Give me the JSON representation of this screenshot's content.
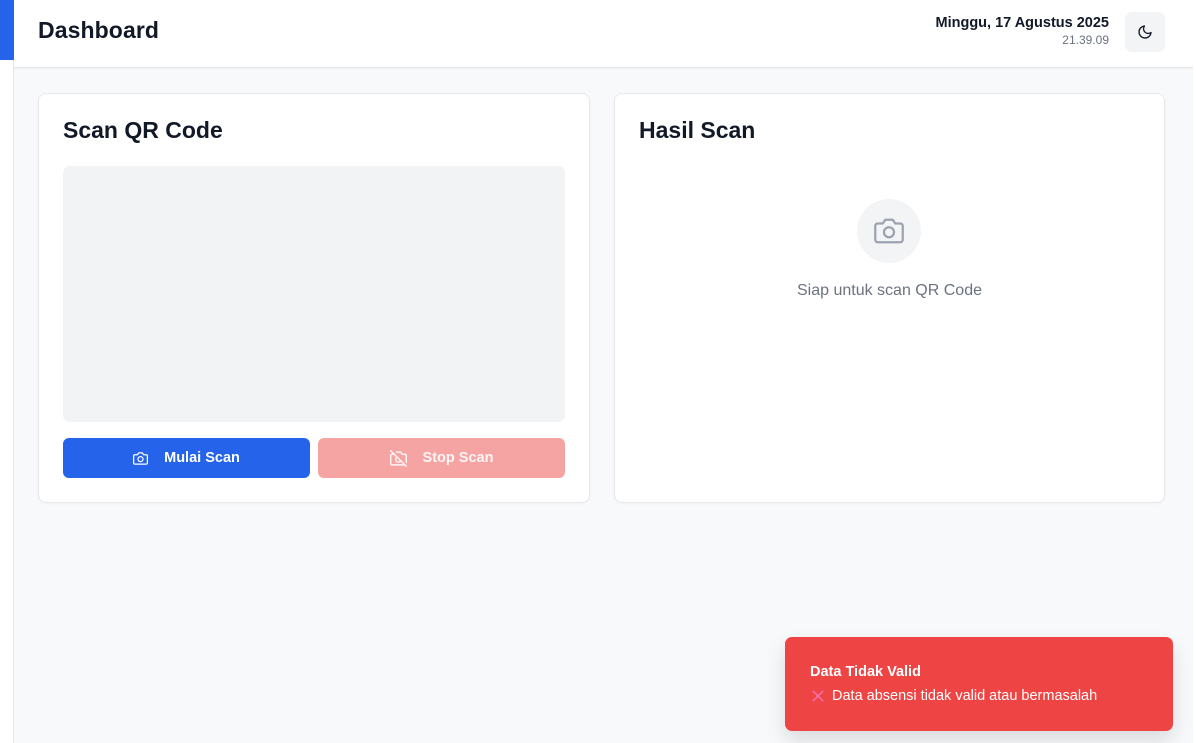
{
  "header": {
    "title": "Dashboard",
    "date": "Minggu, 17 Agustus 2025",
    "time": "21.39.09",
    "theme_icon": "moon-icon"
  },
  "scan_card": {
    "title": "Scan QR Code",
    "start_button": {
      "label": "Mulai Scan",
      "icon": "camera-icon"
    },
    "stop_button": {
      "label": "Stop Scan",
      "icon": "camera-off-icon",
      "disabled": true
    }
  },
  "result_card": {
    "title": "Hasil Scan",
    "empty_icon": "camera-icon",
    "empty_message": "Siap untuk scan QR Code"
  },
  "toast": {
    "title": "Data Tidak Valid",
    "message": "Data absensi tidak valid atau bermasalah",
    "icon": "x-icon",
    "color": "#ef4444"
  },
  "colors": {
    "primary": "#2563eb",
    "danger": "#ef4444",
    "danger_disabled": "#f5a3a3"
  }
}
